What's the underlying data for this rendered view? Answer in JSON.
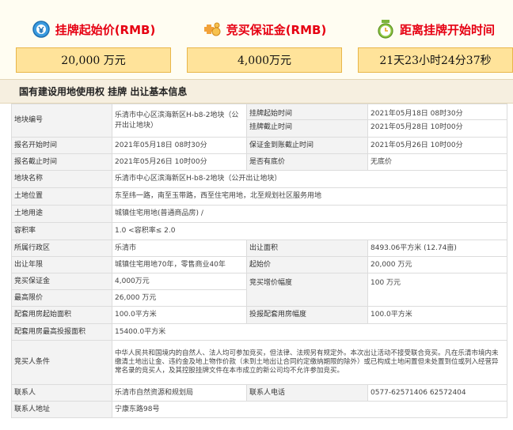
{
  "metrics": [
    {
      "label": "挂牌起始价(RMB)",
      "value": "20,000 万元",
      "icon": "price-icon"
    },
    {
      "label": "竞买保证金(RMB)",
      "value": "4,000万元",
      "icon": "deposit-icon"
    },
    {
      "label": "距离挂牌开始时间",
      "value": "21天23小时24分37秒",
      "icon": "clock-icon"
    }
  ],
  "section_title": "国有建设用地使用权 挂牌 出让基本信息",
  "table": {
    "land_no_k": "地块编号",
    "land_no_v": "乐清市中心区滨海新区H-b8-2地块（公开出让地块）",
    "list_start_k": "挂牌起始时间",
    "list_start_v": "2021年05月18日  08时30分",
    "list_end_k": "挂牌截止时间",
    "list_end_v": "2021年05月28日  10时00分",
    "apply_start_k": "报名开始时间",
    "apply_start_v": "2021年05月18日  08时30分",
    "deposit_deadline_k": "保证金到账截止时间",
    "deposit_deadline_v": "2021年05月26日  10时00分",
    "apply_end_k": "报名截止时间",
    "apply_end_v": "2021年05月26日  10时00分",
    "reserve_k": "是否有底价",
    "reserve_v": "无底价",
    "land_name_k": "地块名称",
    "land_name_v": "乐清市中心区滨海新区H-b8-2地块（公开出让地块）",
    "location_k": "土地位置",
    "location_v": "东至纬一路，南至玉带路，西至住宅用地，北至规划社区服务用地",
    "usage_k": "土地用途",
    "usage_v": "城镇住宅用地(普通商品房) /",
    "far_k": "容积率",
    "far_v": "1.0 <容积率≤ 2.0",
    "district_k": "所属行政区",
    "district_v": "乐清市",
    "area_k": "出让面积",
    "area_v": "8493.06平方米 (12.74亩)",
    "term_k": "出让年限",
    "term_v": "城镇住宅用地70年，零售商业40年",
    "start_price_k": "起始价",
    "start_price_v": "20,000 万元",
    "bid_deposit_k": "竞买保证金",
    "bid_deposit_v": "4,000万元",
    "increment_k": "竞买增价幅度",
    "increment_v": "100 万元",
    "max_price_k": "最高限价",
    "max_price_v": "26,000 万元",
    "housing_start_k": "配套用房起始面积",
    "housing_start_v": "100.0平方米",
    "housing_bid_k": "投报配套用房幅度",
    "housing_bid_v": "100.0平方米",
    "housing_max_k": "配套用房最高投报面积",
    "housing_max_v": "15400.0平方米",
    "bidder_k": "竞买人条件",
    "bidder_v": "中华人民共和国境内的自然人、法人均可参加竞买，但法律、法规另有规定外。本次出让活动不接受联合竞买。凡在乐清市境内未缴清土地出让金、违约金及地上物作价款（未到土地出让合同约定缴纳期限的除外）或已构成土地闲置但未处置到位或列入经营异常名录的竞买人，及其控股挂牌文件在本市成立的新公司均不允许参加竞买。",
    "contact_k": "联系人",
    "contact_v": "乐清市自然资源和规划局",
    "phone_k": "联系人电话",
    "phone_v": "0577-62571406 62572404",
    "address_k": "联系人地址",
    "address_v": "宁康东路98号"
  }
}
